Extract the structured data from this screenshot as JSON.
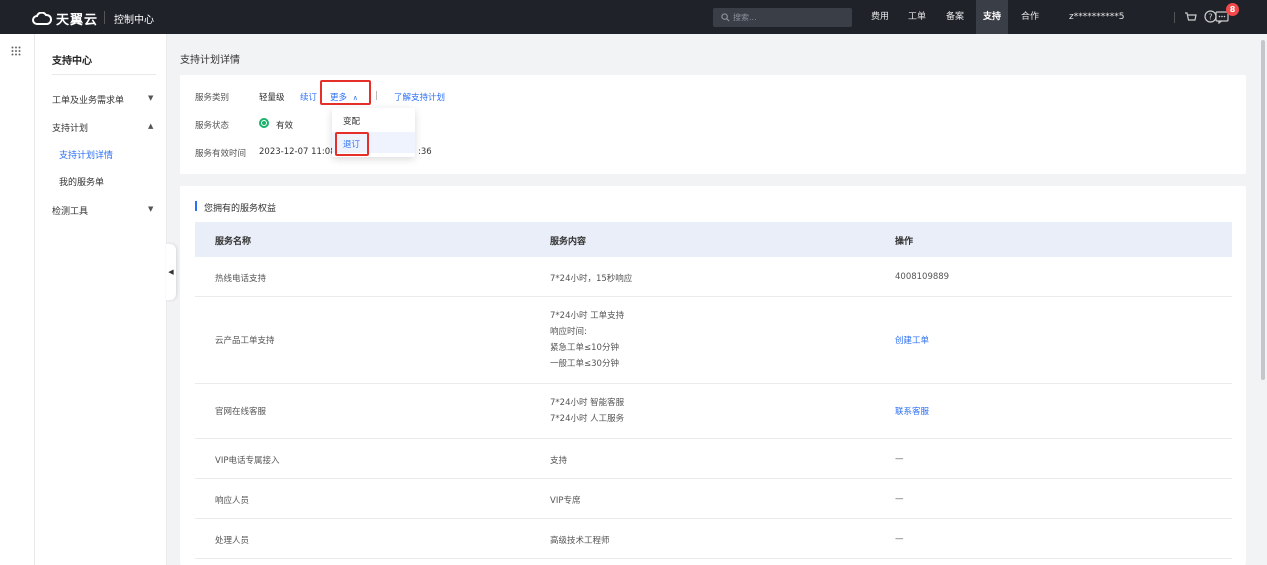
{
  "topbar": {
    "brand": "天翼云",
    "console": "控制中心",
    "search_placeholder": "搜索...",
    "nav": [
      "费用",
      "工单",
      "备案",
      "支持",
      "合作"
    ],
    "active_nav": "支持",
    "user": "z**********5",
    "notification_count": "8"
  },
  "sidebar": {
    "title": "支持中心",
    "items": [
      {
        "label": "工单及业务需求单"
      },
      {
        "label": "支持计划"
      },
      {
        "label": "支持计划详情"
      },
      {
        "label": "我的服务单"
      },
      {
        "label": "检测工具"
      }
    ]
  },
  "page": {
    "title": "支持计划详情"
  },
  "plan": {
    "category_label": "服务类别",
    "category_value": "轻量级",
    "renew_link": "续订",
    "more_link": "更多",
    "learn_link": "了解支持计划",
    "status_label": "服务状态",
    "status_value": "有效",
    "time_label": "服务有效时间",
    "time_start": "2023-12-07 11:08:3",
    "time_end_tail": ":36"
  },
  "more_menu": {
    "items": [
      "变配",
      "退订"
    ]
  },
  "benefits": {
    "title": "您拥有的服务权益",
    "columns": [
      "服务名称",
      "服务内容",
      "操作"
    ],
    "rows": [
      {
        "name": "热线电话支持",
        "content": [
          "7*24小时，15秒响应"
        ],
        "action": "4008109889",
        "action_link": false
      },
      {
        "name": "云产品工单支持",
        "content": [
          "7*24小时 工单支持",
          "响应时间:",
          "紧急工单≤10分钟",
          "一般工单≤30分钟"
        ],
        "action": "创建工单",
        "action_link": true
      },
      {
        "name": "官网在线客服",
        "content": [
          "7*24小时 智能客服",
          "7*24小时 人工服务"
        ],
        "action": "联系客服",
        "action_link": true
      },
      {
        "name": "VIP电话专属接入",
        "content": [
          "支持"
        ],
        "action": "—",
        "action_link": false
      },
      {
        "name": "响应人员",
        "content": [
          "VIP专席"
        ],
        "action": "—",
        "action_link": false
      },
      {
        "name": "处理人员",
        "content": [
          "高级技术工程师"
        ],
        "action": "—",
        "action_link": false
      }
    ]
  },
  "colors": {
    "accent": "#2b6ff6",
    "topbar": "#1f2229",
    "status_green": "#1bb36b",
    "highlight_red": "#e5302a",
    "badge_red": "#f24a4a"
  }
}
